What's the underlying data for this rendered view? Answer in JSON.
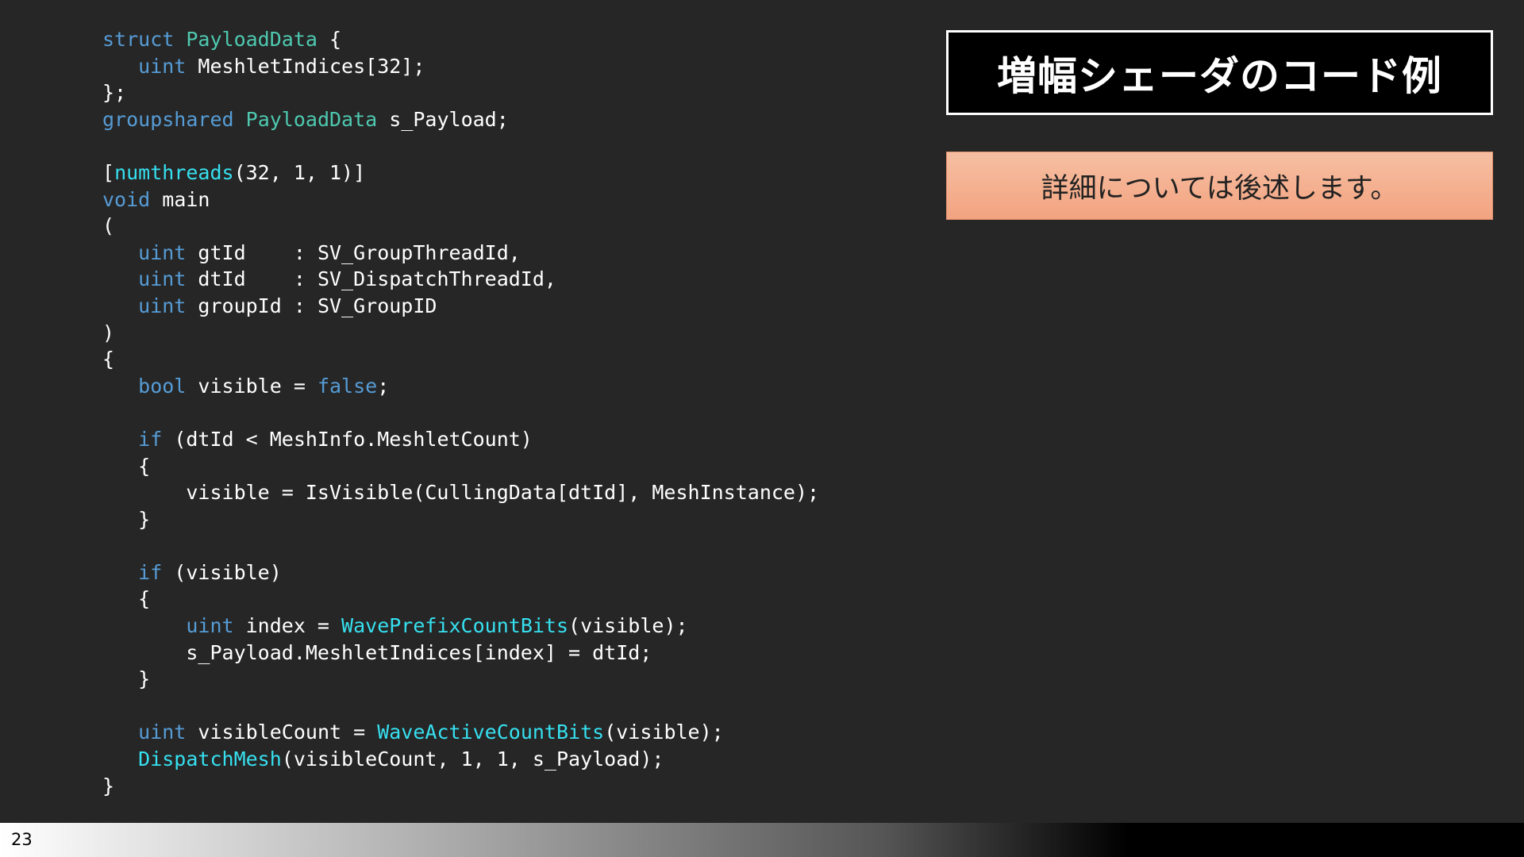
{
  "slide": {
    "title": "増幅シェーダのコード例",
    "note": "詳細については後述します。",
    "page_number": "23"
  },
  "colors": {
    "background": "#262626",
    "keyword": "#569cd6",
    "type": "#4ec9b0",
    "function": "#36e0f0",
    "plain": "#ffffff"
  },
  "code": {
    "language": "hlsl",
    "lines": [
      [
        {
          "t": "struct",
          "c": "kw"
        },
        {
          "t": " ",
          "c": "pl"
        },
        {
          "t": "PayloadData",
          "c": "ty"
        },
        {
          "t": " {",
          "c": "pl"
        }
      ],
      [
        {
          "t": "   ",
          "c": "pl"
        },
        {
          "t": "uint",
          "c": "kw"
        },
        {
          "t": " MeshletIndices[32];",
          "c": "pl"
        }
      ],
      [
        {
          "t": "};",
          "c": "pl"
        }
      ],
      [
        {
          "t": "groupshared",
          "c": "kw"
        },
        {
          "t": " ",
          "c": "pl"
        },
        {
          "t": "PayloadData",
          "c": "ty"
        },
        {
          "t": " s_Payload;",
          "c": "pl"
        }
      ],
      [],
      [
        {
          "t": "[",
          "c": "pl"
        },
        {
          "t": "numthreads",
          "c": "fn"
        },
        {
          "t": "(32, 1, 1)]",
          "c": "pl"
        }
      ],
      [
        {
          "t": "void",
          "c": "kw"
        },
        {
          "t": " main",
          "c": "pl"
        }
      ],
      [
        {
          "t": "(",
          "c": "pl"
        }
      ],
      [
        {
          "t": "   ",
          "c": "pl"
        },
        {
          "t": "uint",
          "c": "kw"
        },
        {
          "t": " gtId    : SV_GroupThreadId,",
          "c": "pl"
        }
      ],
      [
        {
          "t": "   ",
          "c": "pl"
        },
        {
          "t": "uint",
          "c": "kw"
        },
        {
          "t": " dtId    : SV_DispatchThreadId,",
          "c": "pl"
        }
      ],
      [
        {
          "t": "   ",
          "c": "pl"
        },
        {
          "t": "uint",
          "c": "kw"
        },
        {
          "t": " groupId : SV_GroupID",
          "c": "pl"
        }
      ],
      [
        {
          "t": ")",
          "c": "pl"
        }
      ],
      [
        {
          "t": "{",
          "c": "pl"
        }
      ],
      [
        {
          "t": "   ",
          "c": "pl"
        },
        {
          "t": "bool",
          "c": "kw"
        },
        {
          "t": " visible = ",
          "c": "pl"
        },
        {
          "t": "false",
          "c": "kw"
        },
        {
          "t": ";",
          "c": "pl"
        }
      ],
      [],
      [
        {
          "t": "   ",
          "c": "pl"
        },
        {
          "t": "if",
          "c": "kw"
        },
        {
          "t": " (dtId < MeshInfo.MeshletCount)",
          "c": "pl"
        }
      ],
      [
        {
          "t": "   {",
          "c": "pl"
        }
      ],
      [
        {
          "t": "       visible = IsVisible(CullingData[dtId], MeshInstance);",
          "c": "pl"
        }
      ],
      [
        {
          "t": "   }",
          "c": "pl"
        }
      ],
      [],
      [
        {
          "t": "   ",
          "c": "pl"
        },
        {
          "t": "if",
          "c": "kw"
        },
        {
          "t": " (visible)",
          "c": "pl"
        }
      ],
      [
        {
          "t": "   {",
          "c": "pl"
        }
      ],
      [
        {
          "t": "       ",
          "c": "pl"
        },
        {
          "t": "uint",
          "c": "kw"
        },
        {
          "t": " index = ",
          "c": "pl"
        },
        {
          "t": "WavePrefixCountBits",
          "c": "fn"
        },
        {
          "t": "(visible);",
          "c": "pl"
        }
      ],
      [
        {
          "t": "       s_Payload.MeshletIndices[index] = dtId;",
          "c": "pl"
        }
      ],
      [
        {
          "t": "   }",
          "c": "pl"
        }
      ],
      [],
      [
        {
          "t": "   ",
          "c": "pl"
        },
        {
          "t": "uint",
          "c": "kw"
        },
        {
          "t": " visibleCount = ",
          "c": "pl"
        },
        {
          "t": "WaveActiveCountBits",
          "c": "fn"
        },
        {
          "t": "(visible);",
          "c": "pl"
        }
      ],
      [
        {
          "t": "   ",
          "c": "pl"
        },
        {
          "t": "DispatchMesh",
          "c": "fn"
        },
        {
          "t": "(visibleCount, 1, 1, s_Payload);",
          "c": "pl"
        }
      ],
      [
        {
          "t": "}",
          "c": "pl"
        }
      ]
    ]
  }
}
